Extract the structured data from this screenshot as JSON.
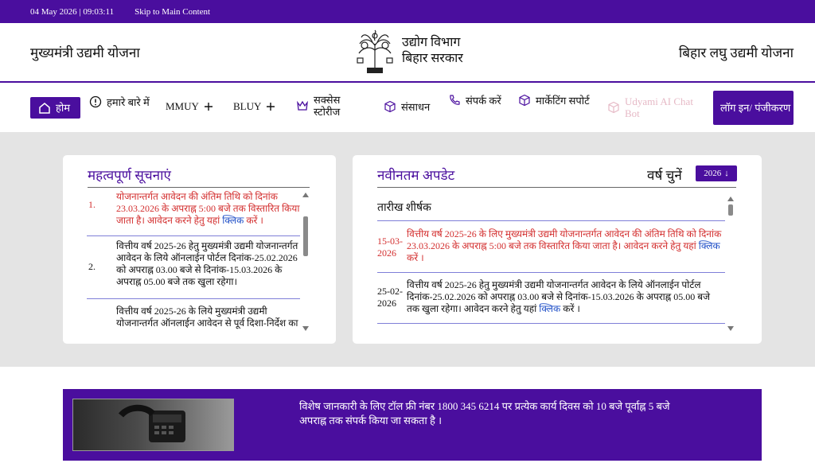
{
  "topbar": {
    "datetime": "04 May 2026 | 09:03:11",
    "skip_link": "Skip to Main Content"
  },
  "header": {
    "left_title": "मुख्यमंत्री उद्यमी योजना",
    "dept_line1": "उद्योग विभाग",
    "dept_line2": "बिहार सरकार",
    "right_title": "बिहार लघु उद्यमी योजना",
    "logo_icon": "bihar-emblem-icon"
  },
  "nav": {
    "home": "होम",
    "about": "हमारे बारे में",
    "mmuy": "MMUY",
    "bluy": "BLUY",
    "success": "सक्सेस स्टोरीज",
    "resources": "संसाधन",
    "contact": "संपर्क करें",
    "marketing": "मार्केटिंग सपोर्ट",
    "chatbot": "Udyami AI Chat Bot",
    "login": "लॉग इन/ पंजीकरण"
  },
  "notices": {
    "title": "महत्वपूर्ण सूचनाएं",
    "items": [
      {
        "num": "1.",
        "text": "योजनान्तर्गत आवेदन की अंतिम तिथि को दिनांक 23.03.2026 के अपराह्न 5:00 बजे तक विस्तारित किया जाता है। आवेदन करने हेतु यहां ",
        "link": "क्लिक",
        "tail": " करें ।"
      },
      {
        "num": "2.",
        "text": "वित्तीय वर्ष 2025-26 हेतु मुख्यमंत्री उद्यमी योजनान्तर्गत आवेदन के लिये ऑनलाईन पोर्टल दिनांक-25.02.2026 को अपराह्न 03.00 बजे से दिनांक-15.03.2026 के अपराह्न 05.00 बजे तक खुला रहेगा।"
      },
      {
        "num": "",
        "text": "वित्तीय वर्ष 2025-26 के लिये मुख्यमंत्री उद्यमी योजनान्तर्गत ऑनलाईन आवेदन से पूर्व दिशा-निर्देश का"
      }
    ]
  },
  "updates": {
    "title": "नवीनतम अपडेट",
    "year_label": "वर्ष चुनें",
    "year_value": "2026",
    "column_header": "तारीख शीर्षक",
    "items": [
      {
        "date": "15-03-2026",
        "text": "वित्तीय वर्ष 2025-26 के लिए मुख्यमंत्री उद्यमी योजनान्तर्गत आवेदन की अंतिम तिथि को दिनांक 23.03.2026 के अपराह्न 5:00 बजे तक विस्तारित किया जाता है। आवेदन करने हेतु यहां ",
        "link": "क्लिक",
        "tail": " करें ।"
      },
      {
        "date": "25-02-2026",
        "text": "वित्तीय वर्ष 2025-26 हेतु मुख्यमंत्री उद्यमी योजनान्तर्गत आवेदन के लिये ऑनलाईन पोर्टल दिनांक-25.02.2026 को अपराह्न 03.00 बजे से दिनांक-15.03.2026 के अपराह्न 05.00 बजे तक खुला रहेगा। आवेदन करने हेतु यहां ",
        "link": "क्लिक",
        "tail": " करें ।"
      }
    ]
  },
  "banner": {
    "text": "विशेष जानकारी के लिए टॉल फ्री नंबर 1800 345 6214 पर प्रत्येक कार्य दिवस को 10 बजे पूर्वाह्न 5 बजे अपराह्न तक संपर्क किया जा सकता है ।",
    "photo_icon": "telephone-photo"
  },
  "colors": {
    "brand": "#4a0e9e",
    "alert": "#d32f2f",
    "link": "#1f4fc7",
    "background_gray": "#e4e4e4"
  }
}
